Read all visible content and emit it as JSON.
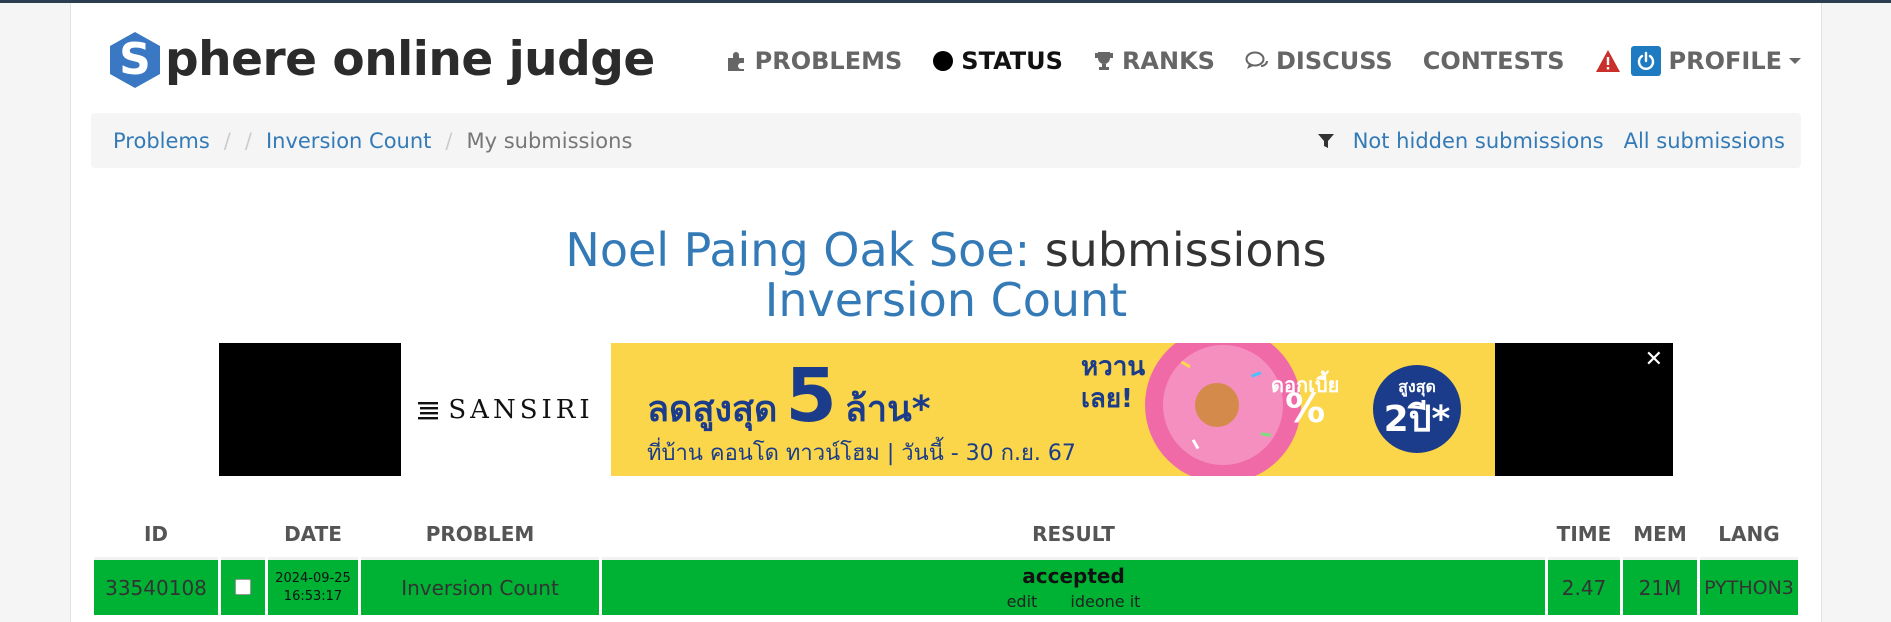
{
  "logo": {
    "letter": "S",
    "text": "phere online judge"
  },
  "nav": {
    "problems": "PROBLEMS",
    "status": "STATUS",
    "ranks": "RANKS",
    "discuss": "DISCUSS",
    "contests": "CONTESTS",
    "profile": "PROFILE"
  },
  "breadcrumb": {
    "problems": "Problems",
    "sep": "/",
    "problem": "Inversion Count",
    "current": "My submissions",
    "not_hidden": "Not hidden submissions",
    "all": "All submissions"
  },
  "title": {
    "user": "Noel Paing Oak Soe:",
    "word": "submissions",
    "problem": "Inversion Count"
  },
  "ad": {
    "brand": "SANSIRI",
    "line1_a": "ลดสูงสุด",
    "line1_num": "5",
    "line1_b": "ล้าน*",
    "line2": "ที่บ้าน คอนโด ทาวน์โฮม | วันนี้ - 30 ก.ย. 67",
    "sweet_1": "หวาน",
    "sweet_2": "เลย!",
    "interest": "ดอกเบี้ย",
    "pct": "%",
    "years_top": "สูงสุด",
    "years_num": "2ปี*",
    "close": "✕"
  },
  "table": {
    "headers": {
      "id": "ID",
      "date": "DATE",
      "problem": "PROBLEM",
      "result": "RESULT",
      "time": "TIME",
      "mem": "MEM",
      "lang": "LANG"
    },
    "rows": [
      {
        "id": "33540108",
        "date": "2024-09-25",
        "time_of_day": "16:53:17",
        "problem": "Inversion Count",
        "result": "accepted",
        "edit": "edit",
        "ideone": "ideone it",
        "time": "2.47",
        "mem": "21M",
        "lang": "PYTHON3"
      }
    ]
  },
  "colors": {
    "accent": "#337ab7",
    "accepted": "#00b233",
    "logo": "#3a78c3"
  }
}
